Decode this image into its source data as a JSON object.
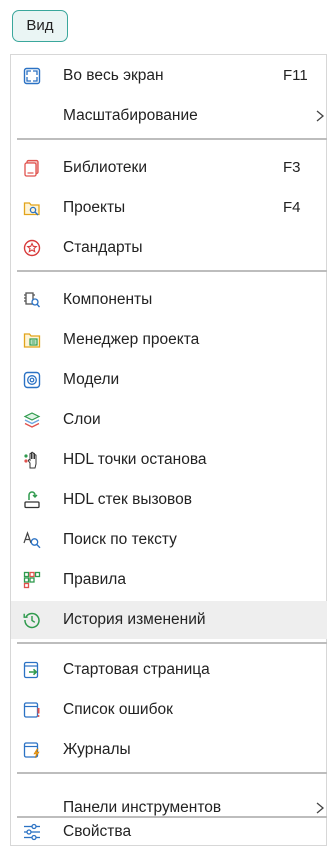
{
  "button": {
    "label": "Вид"
  },
  "menu": {
    "items": [
      {
        "label": "Во весь экран",
        "shortcut": "F11",
        "icon": "fullscreen-icon"
      },
      {
        "label": "Масштабирование",
        "submenu": true
      },
      {
        "label": "Библиотеки",
        "shortcut": "F3",
        "icon": "libraries-icon"
      },
      {
        "label": "Проекты",
        "shortcut": "F4",
        "icon": "projects-icon"
      },
      {
        "label": "Стандарты",
        "icon": "standards-icon"
      },
      {
        "label": "Компоненты",
        "icon": "components-icon"
      },
      {
        "label": "Менеджер проекта",
        "icon": "project-manager-icon"
      },
      {
        "label": "Модели",
        "icon": "models-icon"
      },
      {
        "label": "Слои",
        "icon": "layers-icon"
      },
      {
        "label": "HDL точки останова",
        "icon": "breakpoints-icon"
      },
      {
        "label": "HDL стек вызовов",
        "icon": "call-stack-icon"
      },
      {
        "label": "Поиск по тексту",
        "icon": "text-search-icon"
      },
      {
        "label": "Правила",
        "icon": "rules-icon"
      },
      {
        "label": "История изменений",
        "icon": "history-icon",
        "highlighted": true
      },
      {
        "label": "Стартовая страница",
        "icon": "start-page-icon"
      },
      {
        "label": "Список ошибок",
        "icon": "error-list-icon"
      },
      {
        "label": "Журналы",
        "icon": "logs-icon"
      },
      {
        "label": "Панели инструментов",
        "submenu": true
      },
      {
        "label": "Свойства",
        "icon": "properties-icon"
      }
    ]
  },
  "colors": {
    "accent": "#3aa79c",
    "highlight": "#eeeeee"
  }
}
